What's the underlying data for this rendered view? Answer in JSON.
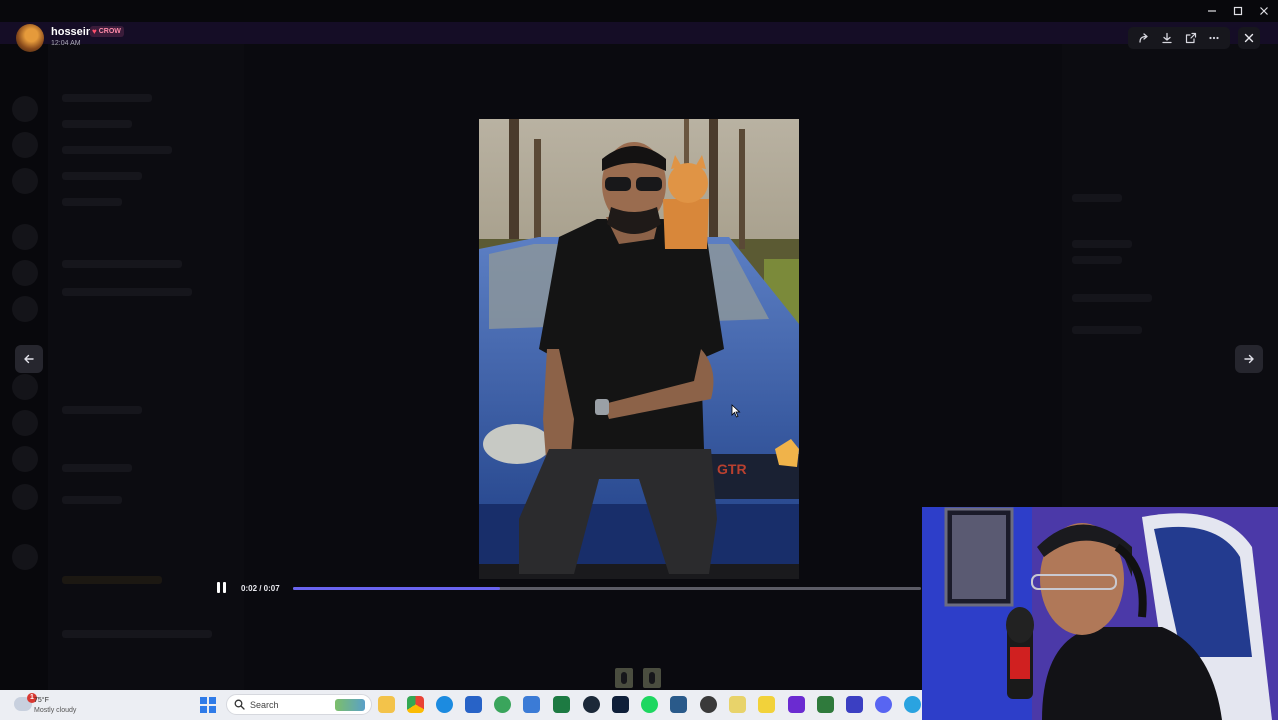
{
  "lightbox": {
    "author": "hossein",
    "tag": "CROW",
    "time": "12:04 AM"
  },
  "video": {
    "current_time": "0:02",
    "duration": "0:07",
    "time_display": "0:02 / 0:07",
    "progress": 0.33,
    "state": "playing"
  },
  "icons": {
    "forward": "forward-icon",
    "download": "download-icon",
    "open_external": "open-external-icon",
    "more": "more-icon",
    "close": "close-icon",
    "prev": "arrow-left-icon",
    "next": "arrow-right-icon",
    "pause": "pause-icon"
  },
  "taskbar": {
    "weather_temp": "75°F",
    "weather_condition": "Mostly cloudy",
    "weather_badge": "1",
    "search_placeholder": "Search"
  },
  "colors": {
    "accent": "#6a64f0",
    "header_bar": "#150d26"
  }
}
